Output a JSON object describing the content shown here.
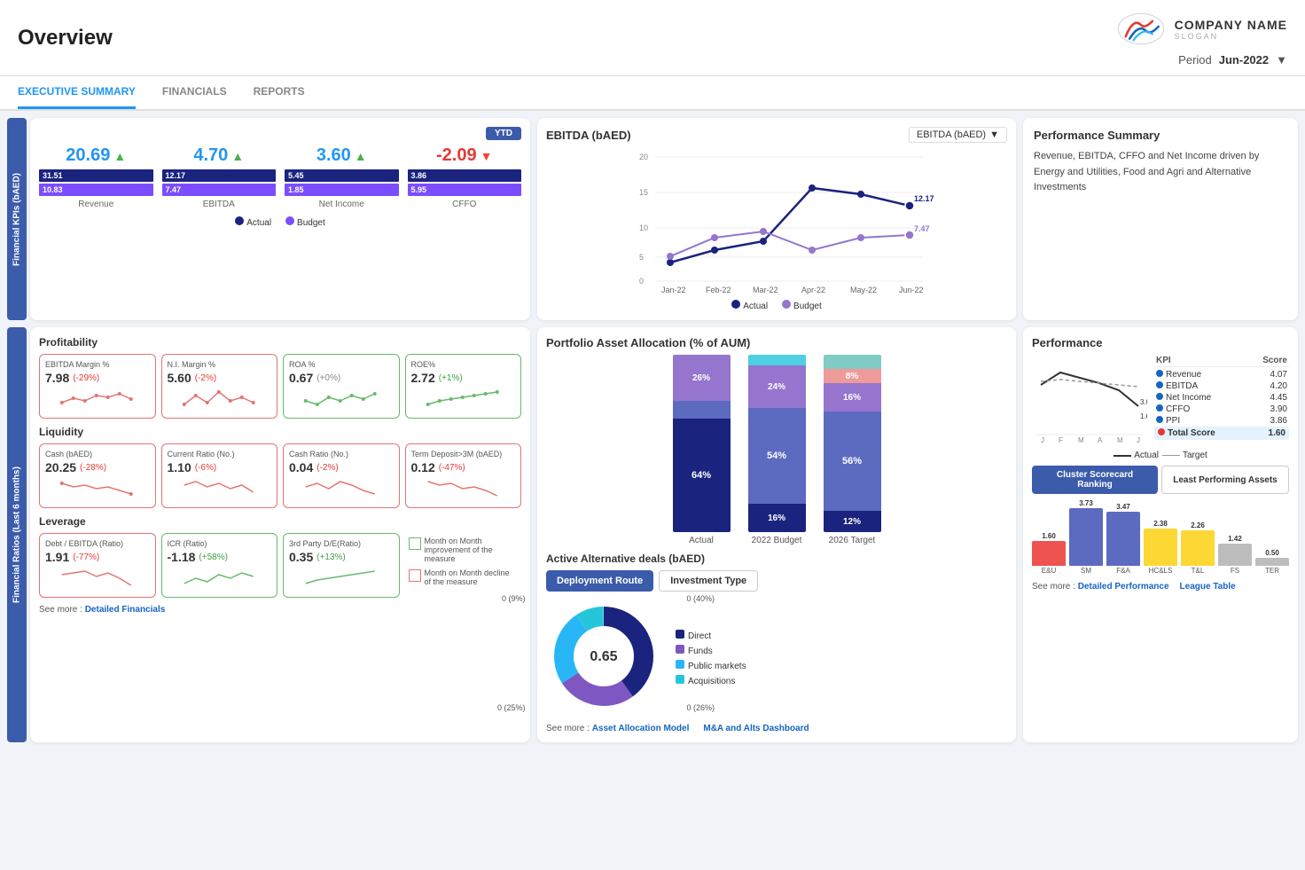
{
  "header": {
    "title": "Overview",
    "company_name": "COMPANY NAME",
    "company_slogan": "SLOGAN",
    "period_label": "Period",
    "period_value": "Jun-2022"
  },
  "tabs": [
    {
      "label": "EXECUTIVE SUMMARY",
      "active": true
    },
    {
      "label": "FINANCIALS",
      "active": false
    },
    {
      "label": "REPORTS",
      "active": false
    }
  ],
  "kpi_section": {
    "badge": "YTD",
    "items": [
      {
        "value": "20.69",
        "trend": "up",
        "bar1": "31.51",
        "bar2": "10.83",
        "label": "Revenue"
      },
      {
        "value": "4.70",
        "trend": "up",
        "bar1": "12.17",
        "bar2": "7.47",
        "label": "EBITDA"
      },
      {
        "value": "3.60",
        "trend": "up",
        "bar1": "5.45",
        "bar2": "1.85",
        "label": "Net Income"
      },
      {
        "value": "-2.09",
        "trend": "down",
        "bar1": "3.86",
        "bar2": "5.95",
        "label": "CFFO"
      }
    ],
    "legend_actual": "Actual",
    "legend_budget": "Budget"
  },
  "ebitda": {
    "title": "EBITDA (bAED)",
    "select_label": "EBITDA (bAED)",
    "y_max": 20,
    "months": [
      "Jan-22",
      "Feb-22",
      "Mar-22",
      "Apr-22",
      "May-22",
      "Jun-22"
    ],
    "actual_values": [
      3,
      5,
      6.5,
      15,
      14,
      12.17
    ],
    "budget_values": [
      4,
      7,
      8,
      5,
      7,
      7.47
    ],
    "legend_actual": "Actual",
    "legend_budget": "Budget"
  },
  "perf_summary": {
    "title": "Performance Summary",
    "text": "Revenue, EBITDA, CFFO and Net Income driven by Energy and Utilities, Food and Agri and Alternative Investments"
  },
  "profitability": {
    "group_title": "Profitability",
    "items": [
      {
        "title": "EBITDA Margin %",
        "value": "7.98",
        "change": "(-29%)",
        "change_type": "neg",
        "border": "red"
      },
      {
        "title": "N.I. Margin %",
        "value": "5.60",
        "change": "(-2%)",
        "change_type": "neg",
        "border": "red"
      },
      {
        "title": "ROA %",
        "value": "0.67",
        "change": "(+0%)",
        "change_type": "neutral",
        "border": "green"
      },
      {
        "title": "ROE%",
        "value": "2.72",
        "change": "(+1%)",
        "change_type": "pos",
        "border": "green"
      }
    ]
  },
  "liquidity": {
    "group_title": "Liquidity",
    "items": [
      {
        "title": "Cash (bAED)",
        "value": "20.25",
        "change": "(-28%)",
        "change_type": "neg",
        "border": "red"
      },
      {
        "title": "Current Ratio (No.)",
        "value": "1.10",
        "change": "(-6%)",
        "change_type": "neg",
        "border": "red"
      },
      {
        "title": "Cash Ratio (No.)",
        "value": "0.04",
        "change": "(-2%)",
        "change_type": "neg",
        "border": "red"
      },
      {
        "title": "Term Deposit>3M (bAED)",
        "value": "0.12",
        "change": "(-47%)",
        "change_type": "neg",
        "border": "red"
      }
    ]
  },
  "leverage": {
    "group_title": "Leverage",
    "items": [
      {
        "title": "Debt / EBITDA (Ratio)",
        "value": "1.91",
        "change": "(-77%)",
        "change_type": "neg",
        "border": "red"
      },
      {
        "title": "ICR (Ratio)",
        "value": "-1.18",
        "change": "(+58%)",
        "change_type": "pos",
        "border": "green"
      },
      {
        "title": "3rd Party D/E(Ratio)",
        "value": "0.35",
        "change": "(+13%)",
        "change_type": "pos",
        "border": "green"
      }
    ],
    "legend": [
      {
        "label": "Month on Month improvement of the measure",
        "color": "green"
      },
      {
        "label": "Month on Month decline of the measure",
        "color": "red"
      }
    ]
  },
  "see_more_ratios": {
    "prefix": "See more :",
    "link": "Detailed Financials"
  },
  "portfolio": {
    "title": "Portfolio Asset Allocation (% of AUM)",
    "bars": [
      {
        "label": "Actual",
        "segments": [
          {
            "pct": 64,
            "color": "#1a237e",
            "label": "64%"
          },
          {
            "pct": 10,
            "color": "#5c6bc0",
            "label": ""
          },
          {
            "pct": 26,
            "color": "#9575cd",
            "label": "26%"
          }
        ]
      },
      {
        "label": "2022 Budget",
        "segments": [
          {
            "pct": 16,
            "color": "#1a237e",
            "label": "16%"
          },
          {
            "pct": 54,
            "color": "#5c6bc0",
            "label": "54%"
          },
          {
            "pct": 24,
            "color": "#9575cd",
            "label": "24%"
          },
          {
            "pct": 6,
            "color": "#4dd0e1",
            "label": ""
          }
        ]
      },
      {
        "label": "2026 Target",
        "segments": [
          {
            "pct": 12,
            "color": "#1a237e",
            "label": "12%"
          },
          {
            "pct": 56,
            "color": "#5c6bc0",
            "label": "56%"
          },
          {
            "pct": 16,
            "color": "#9575cd",
            "label": "16%"
          },
          {
            "pct": 8,
            "color": "#ef9a9a",
            "label": "8%"
          },
          {
            "pct": 8,
            "color": "#80cbc4",
            "label": ""
          }
        ]
      }
    ]
  },
  "deals": {
    "title": "Active Alternative deals (bAED)",
    "tabs": [
      "Deployment Route",
      "Investment Type"
    ],
    "active_tab": 0,
    "donut_value": "0.65",
    "segments": [
      {
        "label": "Direct",
        "value": 40,
        "color": "#1a237e"
      },
      {
        "label": "Funds",
        "value": 26,
        "color": "#7e57c2"
      },
      {
        "label": "Public markets",
        "value": 25,
        "color": "#29b6f6"
      },
      {
        "label": "Acquisitions",
        "value": 9,
        "color": "#26c6da"
      }
    ],
    "labels": [
      "0 (40%)",
      "0 (9%)",
      "0 (25%)",
      "0 (26%)"
    ],
    "see_more": [
      "Asset Allocation Model",
      "M&A and Alts Dashboard"
    ]
  },
  "performance": {
    "title": "Performance",
    "chart_line_points": [
      2.8,
      3.5,
      3.2,
      2.9,
      2.5,
      1.6
    ],
    "months": [
      "J",
      "F",
      "M",
      "A",
      "M",
      "J"
    ],
    "kpis": [
      {
        "label": "Revenue",
        "color": "#1565C0",
        "score": "4.07"
      },
      {
        "label": "EBITDA",
        "color": "#1565C0",
        "score": "4.20"
      },
      {
        "label": "Net Income",
        "color": "#1565C0",
        "score": "4.45"
      },
      {
        "label": "CFFO",
        "color": "#1565C0",
        "score": "3.90"
      },
      {
        "label": "PPI",
        "color": "#1565C0",
        "score": "3.86"
      },
      {
        "label": "Total Score",
        "color": "#e53935",
        "score": "1.60",
        "highlight": true
      }
    ],
    "score_tabs": [
      "Cluster Scorecard Ranking",
      "Least Performing Assets"
    ],
    "active_score_tab": 0,
    "bars": [
      {
        "label": "E&U",
        "value": 1.6,
        "color": "#ef5350"
      },
      {
        "label": "SM",
        "value": 3.73,
        "color": "#5c6bc0"
      },
      {
        "label": "F&A",
        "value": 3.47,
        "color": "#5c6bc0"
      },
      {
        "label": "HC&LS",
        "value": 2.38,
        "color": "#fdd835"
      },
      {
        "label": "T&L",
        "value": 2.26,
        "color": "#fdd835"
      },
      {
        "label": "FS",
        "value": 1.42,
        "color": "#bdbdbd"
      },
      {
        "label": "TER",
        "value": 0.5,
        "color": "#bdbdbd"
      }
    ],
    "axis_max": 4,
    "see_more": [
      "Detailed Performance",
      "League Table"
    ]
  }
}
